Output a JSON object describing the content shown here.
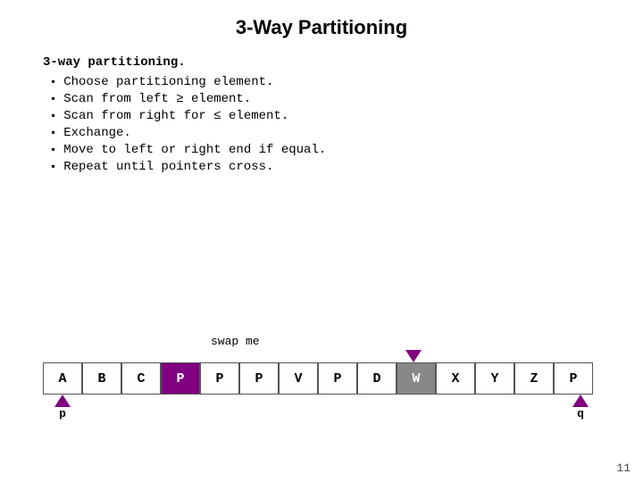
{
  "title": "3-Way Partitioning",
  "section_heading": "3-way partitioning.",
  "bullets": [
    "Choose partitioning element.",
    "Scan from left ≥ element.",
    "Scan from right for ≤ element.",
    "Exchange.",
    "Move to left or right end if equal.",
    "Repeat until pointers cross."
  ],
  "swap_label": "swap me",
  "array": [
    {
      "val": "A",
      "type": "white"
    },
    {
      "val": "B",
      "type": "white"
    },
    {
      "val": "C",
      "type": "white"
    },
    {
      "val": "P",
      "type": "purple"
    },
    {
      "val": "P",
      "type": "white"
    },
    {
      "val": "P",
      "type": "white"
    },
    {
      "val": "V",
      "type": "white"
    },
    {
      "val": "P",
      "type": "white"
    },
    {
      "val": "D",
      "type": "white"
    },
    {
      "val": "W",
      "type": "gray"
    },
    {
      "val": "X",
      "type": "white"
    },
    {
      "val": "Y",
      "type": "white"
    },
    {
      "val": "Z",
      "type": "white"
    },
    {
      "val": "P",
      "type": "white"
    }
  ],
  "pointer_p": "p",
  "pointer_q": "q",
  "page_number": "11"
}
